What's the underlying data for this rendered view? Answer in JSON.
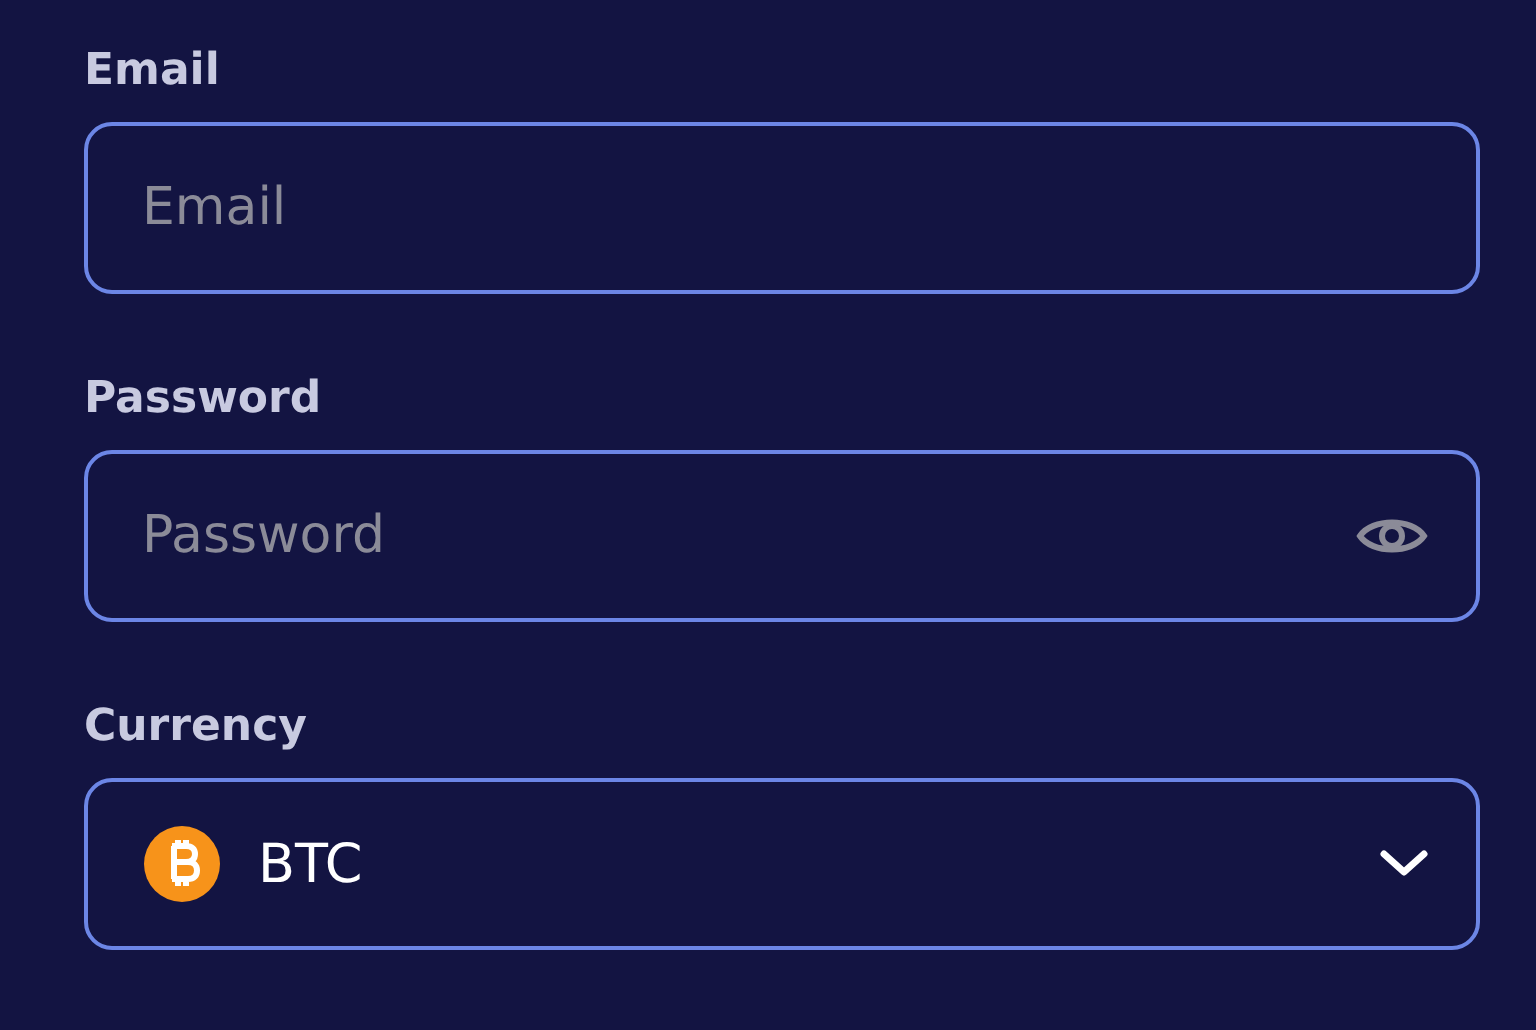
{
  "fields": [
    {
      "kind": "text",
      "label": "Email",
      "placeholder": "Email"
    },
    {
      "kind": "password",
      "label": "Password",
      "placeholder": "Password"
    },
    {
      "kind": "select",
      "label": "Currency",
      "value": "BTC"
    }
  ]
}
